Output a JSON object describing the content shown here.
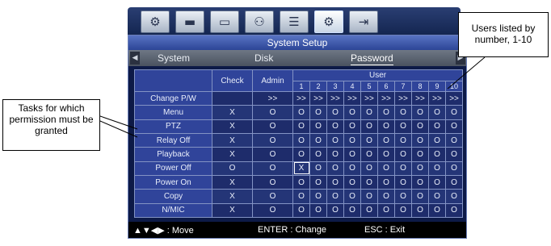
{
  "icons": [
    {
      "name": "settings-gear-icon",
      "glyph": "⚙"
    },
    {
      "name": "display-monitor-icon",
      "glyph": "▬"
    },
    {
      "name": "hdd-storage-icon",
      "glyph": "▭"
    },
    {
      "name": "users-icon",
      "glyph": "⚇"
    },
    {
      "name": "network-icon",
      "glyph": "☰"
    },
    {
      "name": "system-settings-icon",
      "glyph": "⚙"
    },
    {
      "name": "exit-door-icon",
      "glyph": "⇥"
    }
  ],
  "window": {
    "title": "System Setup"
  },
  "tabs": {
    "system": "System",
    "disk": "Disk",
    "password": "Password",
    "left_arrow": "◀",
    "right_arrow": "▶"
  },
  "grid": {
    "col_check": "Check",
    "col_admin": "Admin",
    "col_user": "User",
    "user_numbers": [
      "1",
      "2",
      "3",
      "4",
      "5",
      "6",
      "7",
      "8",
      "9",
      "10"
    ],
    "rows": [
      {
        "label": "Change P/W",
        "check": "",
        "admin": ">>",
        "users": [
          ">>",
          ">>",
          ">>",
          ">>",
          ">>",
          ">>",
          ">>",
          ">>",
          ">>",
          ">>"
        ]
      },
      {
        "label": "Menu",
        "check": "X",
        "admin": "O",
        "users": [
          "O",
          "O",
          "O",
          "O",
          "O",
          "O",
          "O",
          "O",
          "O",
          "O"
        ]
      },
      {
        "label": "PTZ",
        "check": "X",
        "admin": "O",
        "users": [
          "O",
          "O",
          "O",
          "O",
          "O",
          "O",
          "O",
          "O",
          "O",
          "O"
        ]
      },
      {
        "label": "Relay Off",
        "check": "X",
        "admin": "O",
        "users": [
          "O",
          "O",
          "O",
          "O",
          "O",
          "O",
          "O",
          "O",
          "O",
          "O"
        ]
      },
      {
        "label": "Playback",
        "check": "X",
        "admin": "O",
        "users": [
          "O",
          "O",
          "O",
          "O",
          "O",
          "O",
          "O",
          "O",
          "O",
          "O"
        ]
      },
      {
        "label": "Power Off",
        "check": "O",
        "admin": "O",
        "users": [
          "X",
          "O",
          "O",
          "O",
          "O",
          "O",
          "O",
          "O",
          "O",
          "O"
        ]
      },
      {
        "label": "Power On",
        "check": "X",
        "admin": "O",
        "users": [
          "O",
          "O",
          "O",
          "O",
          "O",
          "O",
          "O",
          "O",
          "O",
          "O"
        ]
      },
      {
        "label": "Copy",
        "check": "X",
        "admin": "O",
        "users": [
          "O",
          "O",
          "O",
          "O",
          "O",
          "O",
          "O",
          "O",
          "O",
          "O"
        ]
      },
      {
        "label": "N/MIC",
        "check": "X",
        "admin": "O",
        "users": [
          "O",
          "O",
          "O",
          "O",
          "O",
          "O",
          "O",
          "O",
          "O",
          "O"
        ]
      }
    ]
  },
  "status": {
    "move": "▲▼◀▶ : Move",
    "enter": "ENTER : Change",
    "esc": "ESC : Exit"
  },
  "callouts": {
    "tasks": "Tasks for which permission must be granted",
    "users": "Users listed by number, 1-10"
  }
}
